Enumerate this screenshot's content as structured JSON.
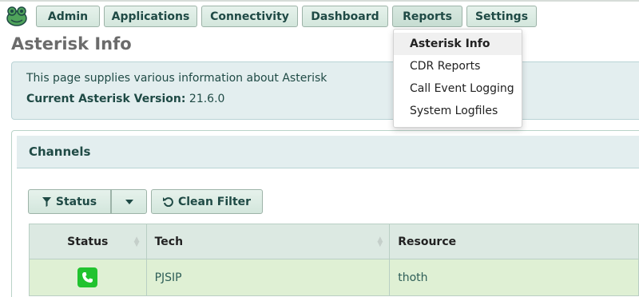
{
  "nav": {
    "items": [
      {
        "label": "Admin"
      },
      {
        "label": "Applications"
      },
      {
        "label": "Connectivity"
      },
      {
        "label": "Dashboard"
      },
      {
        "label": "Reports"
      },
      {
        "label": "Settings"
      }
    ]
  },
  "page": {
    "title": "Asterisk Info"
  },
  "info": {
    "description": "This page supplies various information about Asterisk",
    "version_label": "Current Asterisk Version:",
    "version_value": "21.6.0"
  },
  "channels": {
    "title": "Channels",
    "filter_label": "Status",
    "clean_filter_label": "Clean Filter",
    "columns": [
      "Status",
      "Tech",
      "Resource"
    ],
    "rows": [
      {
        "status": "phone-icon",
        "tech": "PJSIP",
        "resource": "thoth"
      }
    ]
  },
  "reports_menu": {
    "items": [
      {
        "label": "Asterisk Info"
      },
      {
        "label": "CDR Reports"
      },
      {
        "label": "Call Event Logging"
      },
      {
        "label": "System Logfiles"
      }
    ]
  },
  "colors": {
    "accent": "#1f4a45",
    "nav_button": "#dcebe3",
    "status_green": "#21c32f",
    "row_highlight": "#dff0d4"
  }
}
